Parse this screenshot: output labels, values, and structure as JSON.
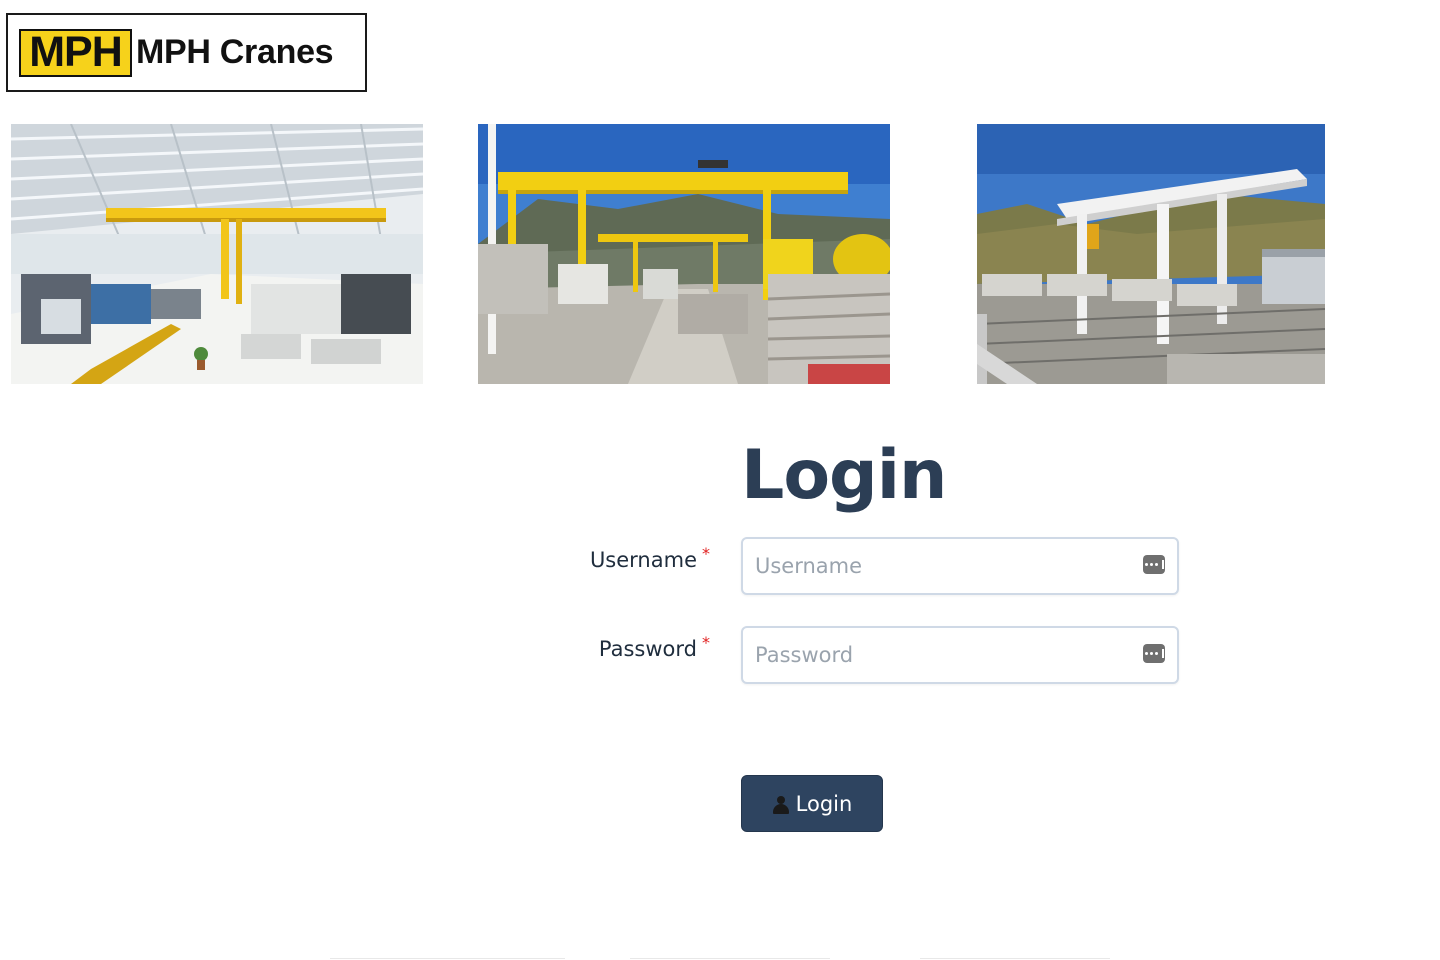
{
  "logo": {
    "mark": "MPH",
    "name": "MPH Cranes"
  },
  "photos": [
    {
      "name": "workshop-crane-photo"
    },
    {
      "name": "yellow-gantry-crane-photo"
    },
    {
      "name": "white-gantry-crane-photo"
    }
  ],
  "login": {
    "title": "Login",
    "username_label": "Username",
    "username_placeholder": "Username",
    "password_label": "Password",
    "password_placeholder": "Password",
    "required_marker": "*",
    "button_label": "Login"
  },
  "icons": {
    "field_icon": "key-icon",
    "button_icon": "user-icon"
  },
  "colors": {
    "brand_yellow": "#f6d21b",
    "title": "#2c3e55",
    "button": "#2e4460",
    "required": "#e02020"
  }
}
